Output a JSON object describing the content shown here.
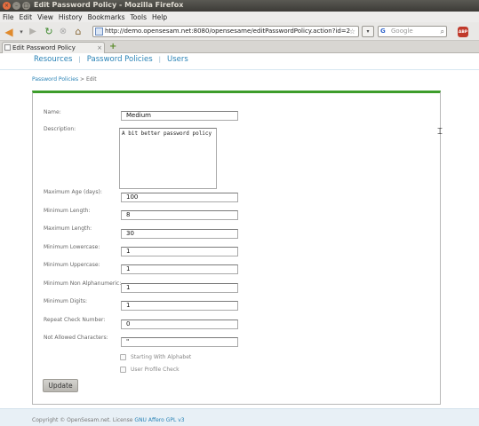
{
  "window": {
    "title": "Edit Password Policy - Mozilla Firefox"
  },
  "menu": [
    "File",
    "Edit",
    "View",
    "History",
    "Bookmarks",
    "Tools",
    "Help"
  ],
  "toolbar": {
    "url": "http://demo.opensesam.net:8080/opensesame/editPasswordPolicy.action?id=2",
    "search_placeholder": "Google",
    "abp_label": "ABP"
  },
  "tab": {
    "label": "Edit Password Policy"
  },
  "nav": {
    "items": [
      "Resources",
      "Password Policies",
      "Users"
    ],
    "separator": "|"
  },
  "breadcrumb": {
    "link": "Password Policies",
    "separator": ">",
    "current": "Edit"
  },
  "form": {
    "name_label": "Name:",
    "name_value": "Medium",
    "description_label": "Description:",
    "description_value": "A bit better password policy",
    "fields": [
      {
        "label": "Maximum Age (days):",
        "value": "100"
      },
      {
        "label": "Minimum Length:",
        "value": "8"
      },
      {
        "label": "Maximum Length:",
        "value": "30"
      },
      {
        "label": "Minimum Lowercase:",
        "value": "1"
      },
      {
        "label": "Minimum Uppercase:",
        "value": "1"
      },
      {
        "label": "Minimum Non Alphanumeric:",
        "value": "1"
      },
      {
        "label": "Minimum Digits:",
        "value": "1"
      },
      {
        "label": "Repeat Check Number:",
        "value": "0"
      },
      {
        "label": "Not Allowed Characters:",
        "value": "\""
      }
    ],
    "checkboxes": [
      {
        "label": "Starting With Alphabet",
        "checked": false
      },
      {
        "label": "User Profile Check",
        "checked": false
      }
    ],
    "submit_label": "Update"
  },
  "footer": {
    "text": "Copyright © OpenSesam.net. License",
    "link": "GNU Affero GPL v3"
  }
}
